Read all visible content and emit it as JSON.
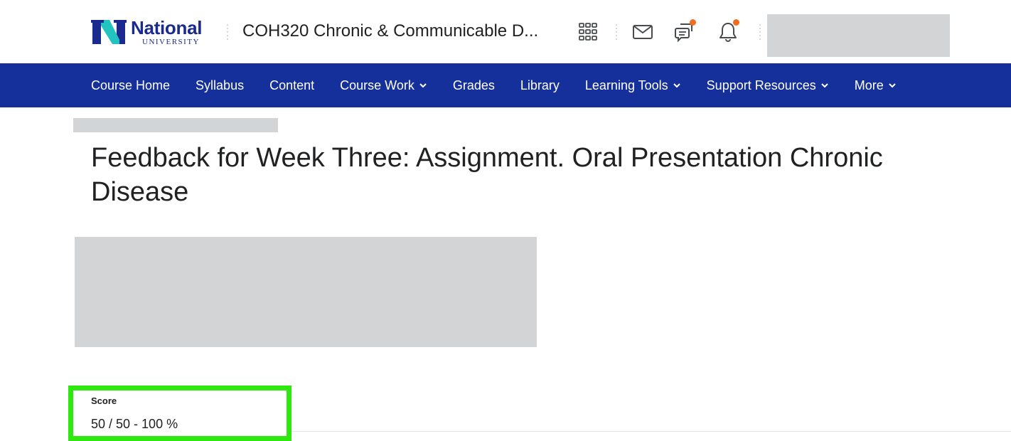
{
  "header": {
    "logo": {
      "name": "National",
      "subtitle": "UNIVERSITY"
    },
    "course_title": "COH320 Chronic & Communicable D...",
    "icons": [
      {
        "name": "apps-grid-icon",
        "label": "Course selector",
        "badge": false
      },
      {
        "name": "mail-icon",
        "label": "Email",
        "badge": false
      },
      {
        "name": "chat-icon",
        "label": "Messages",
        "badge": true
      },
      {
        "name": "bell-icon",
        "label": "Notifications",
        "badge": true
      }
    ],
    "badge_color": "#f26d21"
  },
  "nav": {
    "background": "#15309a",
    "items": [
      {
        "label": "Course Home",
        "dropdown": false
      },
      {
        "label": "Syllabus",
        "dropdown": false
      },
      {
        "label": "Content",
        "dropdown": false
      },
      {
        "label": "Course Work",
        "dropdown": true
      },
      {
        "label": "Grades",
        "dropdown": false
      },
      {
        "label": "Library",
        "dropdown": false
      },
      {
        "label": "Learning Tools",
        "dropdown": true
      },
      {
        "label": "Support Resources",
        "dropdown": true
      },
      {
        "label": "More",
        "dropdown": true
      }
    ]
  },
  "page": {
    "title": "Feedback for Week Three: Assignment. Oral Presentation Chronic Disease",
    "score": {
      "label": "Score",
      "value": "50 / 50 - 100 %",
      "highlight_color": "#2ee80f"
    }
  }
}
